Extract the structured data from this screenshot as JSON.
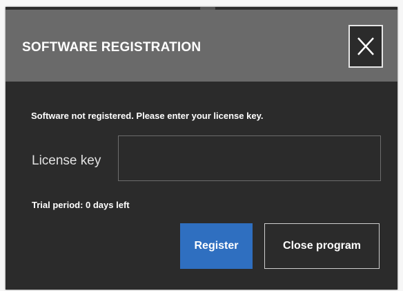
{
  "dialog": {
    "title": "SOFTWARE REGISTRATION",
    "close_icon": "close-icon",
    "message": "Software not registered. Please enter your license key.",
    "license_label": "License key",
    "license_value": "",
    "trial_text": "Trial period: 0 days left",
    "register_label": "Register",
    "close_program_label": "Close program"
  },
  "colors": {
    "titlebar": "#6a6a6a",
    "body": "#2b2b2b",
    "primary_button": "#2f6fc0"
  }
}
